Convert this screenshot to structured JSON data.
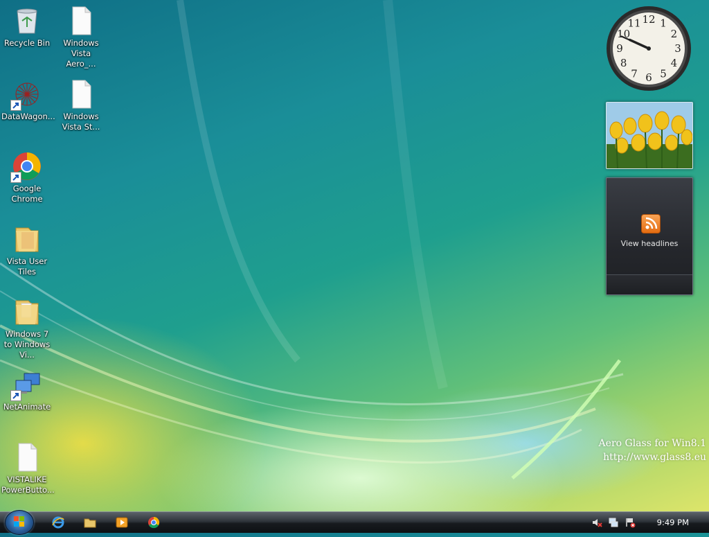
{
  "desktop": {
    "icons": [
      {
        "label": "Recycle Bin",
        "icon": "recycle-bin-icon"
      },
      {
        "label": "Windows Vista Aero_...",
        "icon": "file-icon"
      },
      {
        "label": "DataWagon...",
        "icon": "datawagon-icon"
      },
      {
        "label": "Windows Vista St...",
        "icon": "file-icon"
      },
      {
        "label": "Google Chrome",
        "icon": "chrome-icon"
      },
      {
        "label": "Vista User Tiles",
        "icon": "folder-icon"
      },
      {
        "label": "Windows 7 to Windows Vi...",
        "icon": "folder-icon"
      },
      {
        "label": "NetAnimate",
        "icon": "network-computers-icon"
      },
      {
        "label": "VISTALIKE PowerButto...",
        "icon": "file-icon"
      }
    ]
  },
  "gadgets": {
    "clock": {
      "hour": 9,
      "minute": 49,
      "numerals": [
        "12",
        "1",
        "2",
        "3",
        "4",
        "5",
        "6",
        "7",
        "8",
        "9",
        "10",
        "11"
      ]
    },
    "slideshow": {
      "subject": "yellow tulips"
    },
    "feeds": {
      "label": "View headlines",
      "icon": "rss-icon"
    }
  },
  "watermark": {
    "line1": "Aero Glass for Win8.1",
    "line2": "http://www.glass8.eu"
  },
  "taskbar": {
    "start_icon": "windows-start-icon",
    "quick_launch": [
      "internet-explorer-icon",
      "file-explorer-icon",
      "media-player-icon",
      "chrome-icon"
    ],
    "tray_icons": [
      "volume-muted-icon",
      "network-icon",
      "action-center-icon"
    ],
    "time": "9:49 PM"
  }
}
